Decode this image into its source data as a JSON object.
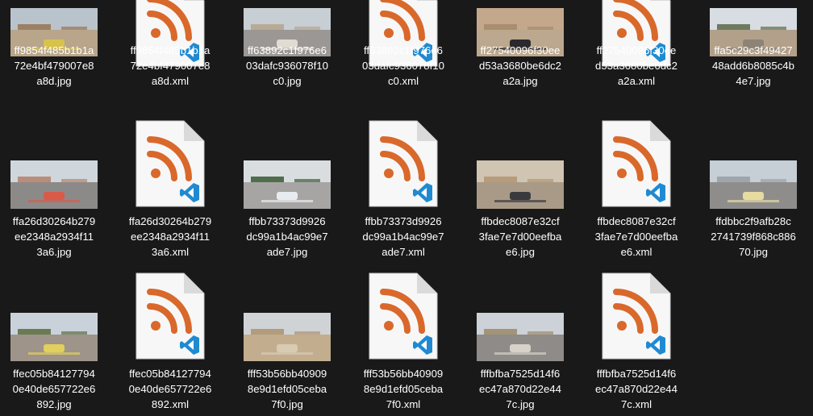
{
  "files": [
    {
      "name": "ff9854f485b1b1a72e4bf479007e8a8d.jpg",
      "lines": [
        "ff9854f485b1b1a",
        "72e4bf479007e8",
        "a8d.jpg"
      ],
      "type": "jpg",
      "scene": {
        "sky": "#b9c3cb",
        "ground": "#b8a58a",
        "building": "#9c8064",
        "accent": "#d8c34a"
      }
    },
    {
      "name": "ff9854f485b1b1a72e4bf479007e8a8d.xml",
      "lines": [
        "ff9854f485b1b1a",
        "72e4bf479007e8",
        "a8d.xml"
      ],
      "type": "xml"
    },
    {
      "name": "ff63892c1f976e603dafc936078f10c0.jpg",
      "lines": [
        "ff63892c1f976e6",
        "03dafc936078f10",
        "c0.jpg"
      ],
      "type": "jpg",
      "scene": {
        "sky": "#c7ced4",
        "ground": "#9a9794",
        "building": "#b7ab96",
        "accent": "#e0dcd2"
      }
    },
    {
      "name": "ff63892c1f976e603dafc936078f10c0.xml",
      "lines": [
        "ff63892c1f976e6",
        "03dafc936078f10",
        "c0.xml"
      ],
      "type": "xml"
    },
    {
      "name": "ff27540096f30eed53a3680be6dc2a2a.jpg",
      "lines": [
        "ff27540096f30ee",
        "d53a3680be6dc2",
        "a2a.jpg"
      ],
      "type": "jpg",
      "scene": {
        "sky": "#c4a88b",
        "ground": "#bca88e",
        "building": "#a98e70",
        "accent": "#2a2a2e"
      }
    },
    {
      "name": "ff27540096f30eed53a3680be6dc2a2a.xml",
      "lines": [
        "ff27540096f30ee",
        "d53a3680be6dc2",
        "a2a.xml"
      ],
      "type": "xml"
    },
    {
      "name": "ffa5c29c3f4942748add6b8085c4b4e7.jpg",
      "lines": [
        "ffa5c29c3f49427",
        "48add6b8085c4b",
        "4e7.jpg"
      ],
      "type": "jpg",
      "scene": {
        "sky": "#d7dde2",
        "ground": "#b2a08a",
        "building": "#6e7a5e",
        "accent": "#8d8377"
      }
    },
    {
      "name": "ffa26d30264b279ee2348a2934f113a6.jpg",
      "lines": [
        "ffa26d30264b279",
        "ee2348a2934f11",
        "3a6.jpg"
      ],
      "type": "jpg",
      "scene": {
        "sky": "#cfd6dc",
        "ground": "#8c8a88",
        "building": "#b98d7a",
        "accent": "#d85b4a"
      }
    },
    {
      "name": "ffa26d30264b279ee2348a2934f113a6.xml",
      "lines": [
        "ffa26d30264b279",
        "ee2348a2934f11",
        "3a6.xml"
      ],
      "type": "xml"
    },
    {
      "name": "ffbb73373d9926dc99a1b4ac99e7ade7.jpg",
      "lines": [
        "ffbb73373d9926",
        "dc99a1b4ac99e7",
        "ade7.jpg"
      ],
      "type": "jpg",
      "scene": {
        "sky": "#d9dde0",
        "ground": "#a6a5a4",
        "building": "#4f6d4a",
        "accent": "#e9ecef"
      }
    },
    {
      "name": "ffbb73373d9926dc99a1b4ac99e7ade7.xml",
      "lines": [
        "ffbb73373d9926",
        "dc99a1b4ac99e7",
        "ade7.xml"
      ],
      "type": "xml"
    },
    {
      "name": "ffbdec8087e32cf3fae7e7d00eefbae6.jpg",
      "lines": [
        "ffbdec8087e32cf",
        "3fae7e7d00eefba",
        "e6.jpg"
      ],
      "type": "jpg",
      "scene": {
        "sky": "#d0c4b2",
        "ground": "#a99a87",
        "building": "#b79b7a",
        "accent": "#3a3a3e"
      }
    },
    {
      "name": "ffbdec8087e32cf3fae7e7d00eefbae6.xml",
      "lines": [
        "ffbdec8087e32cf",
        "3fae7e7d00eefba",
        "e6.xml"
      ],
      "type": "xml"
    },
    {
      "name": "ffdbbc2f9afb28c2741739f868c88670.jpg",
      "lines": [
        "ffdbbc2f9afb28c",
        "2741739f868c886",
        "70.jpg"
      ],
      "type": "jpg",
      "scene": {
        "sky": "#c6ced6",
        "ground": "#8f8d8c",
        "building": "#9fa6ab",
        "accent": "#e6dba0"
      }
    },
    {
      "name": "ffec05b841277940e40de657722e6892.jpg",
      "lines": [
        "ffec05b84127794",
        "0e40de657722e6",
        "892.jpg"
      ],
      "type": "jpg",
      "scene": {
        "sky": "#c9d2da",
        "ground": "#9e948a",
        "building": "#6b7a52",
        "accent": "#e1cf5e"
      }
    },
    {
      "name": "ffec05b841277940e40de657722e6892.xml",
      "lines": [
        "ffec05b84127794",
        "0e40de657722e6",
        "892.xml"
      ],
      "type": "xml"
    },
    {
      "name": "fff53b56bb409098e9d1efd05ceba7f0.jpg",
      "lines": [
        "fff53b56bb40909",
        "8e9d1efd05ceba",
        "7f0.jpg"
      ],
      "type": "jpg",
      "scene": {
        "sky": "#cfd3d6",
        "ground": "#c2ad8f",
        "building": "#b39b7d",
        "accent": "#d8cbb2"
      }
    },
    {
      "name": "fff53b56bb409098e9d1efd05ceba7f0.xml",
      "lines": [
        "fff53b56bb40909",
        "8e9d1efd05ceba",
        "7f0.xml"
      ],
      "type": "xml"
    },
    {
      "name": "fffbfba7525d14f6ec47a870d22e447c.jpg",
      "lines": [
        "fffbfba7525d14f6",
        "ec47a870d22e44",
        "7c.jpg"
      ],
      "type": "jpg",
      "scene": {
        "sky": "#ccd2d7",
        "ground": "#8e8b88",
        "building": "#a39379",
        "accent": "#d6d2c8"
      }
    },
    {
      "name": "fffbfba7525d14f6ec47a870d22e447c.xml",
      "lines": [
        "fffbfba7525d14f6",
        "ec47a870d22e44",
        "7c.xml"
      ],
      "type": "xml"
    }
  ],
  "colors": {
    "background": "#191919",
    "rss_orange": "#d9682b",
    "vscode_blue": "#1f8ad2",
    "doc_page": "#f7f7f7",
    "doc_fold": "#dadada"
  }
}
